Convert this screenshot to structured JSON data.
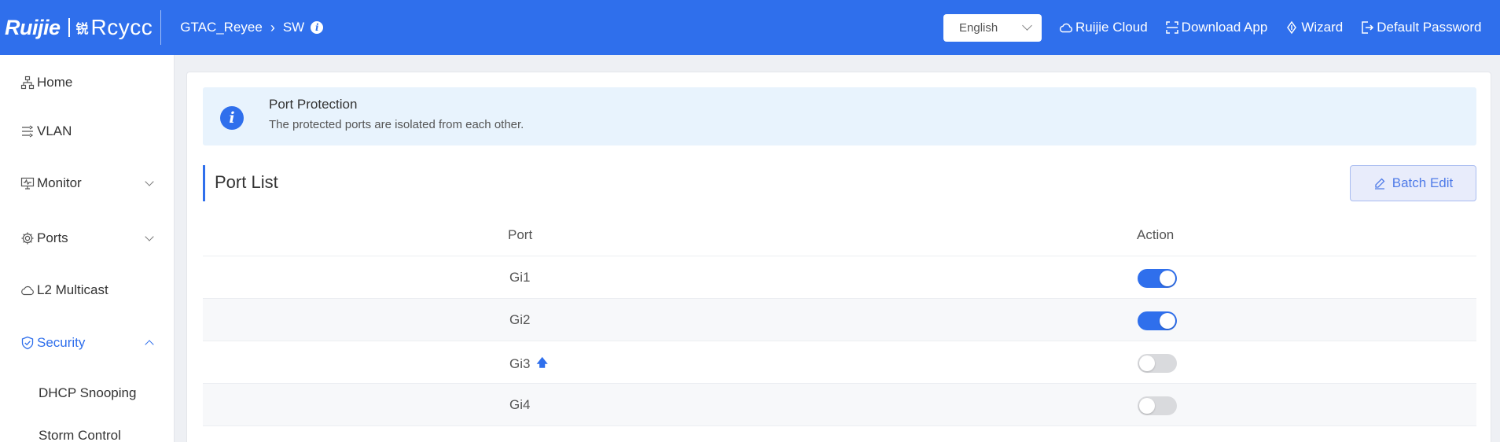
{
  "header": {
    "logo_left": "Ruijie",
    "logo_mark": "锐",
    "logo_right": "Rcycc",
    "breadcrumb": [
      "GTAC_Reyee",
      "SW"
    ],
    "language": "English",
    "links": [
      {
        "label": "Ruijie Cloud",
        "icon": "cloud-icon"
      },
      {
        "label": "Download App",
        "icon": "scan-icon"
      },
      {
        "label": "Wizard",
        "icon": "wizard-icon"
      },
      {
        "label": "Default Password",
        "icon": "logout-icon"
      }
    ]
  },
  "sidebar": {
    "items": [
      {
        "label": "Home",
        "icon": "network-icon"
      },
      {
        "label": "VLAN",
        "icon": "vlan-icon"
      },
      {
        "label": "Monitor",
        "icon": "monitor-icon",
        "expandable": true
      },
      {
        "label": "Ports",
        "icon": "gear-icon",
        "expandable": true
      },
      {
        "label": "L2 Multicast",
        "icon": "cloud-icon"
      },
      {
        "label": "Security",
        "icon": "shield-icon",
        "expandable": true,
        "active": true
      }
    ],
    "sub_items": [
      "DHCP Snooping",
      "Storm Control"
    ]
  },
  "notice": {
    "title": "Port Protection",
    "text": "The protected ports are isolated from each other."
  },
  "section": {
    "title": "Port List",
    "batch_edit_label": "Batch Edit"
  },
  "table": {
    "headers": {
      "port": "Port",
      "action": "Action"
    },
    "rows": [
      {
        "port": "Gi1",
        "enabled": true,
        "uplink": false
      },
      {
        "port": "Gi2",
        "enabled": true,
        "uplink": false
      },
      {
        "port": "Gi3",
        "enabled": false,
        "uplink": true
      },
      {
        "port": "Gi4",
        "enabled": false,
        "uplink": false
      }
    ]
  },
  "colors": {
    "primary": "#2f6fec",
    "notice_bg": "#e8f3fd",
    "toggle_off": "#d9dadd"
  }
}
